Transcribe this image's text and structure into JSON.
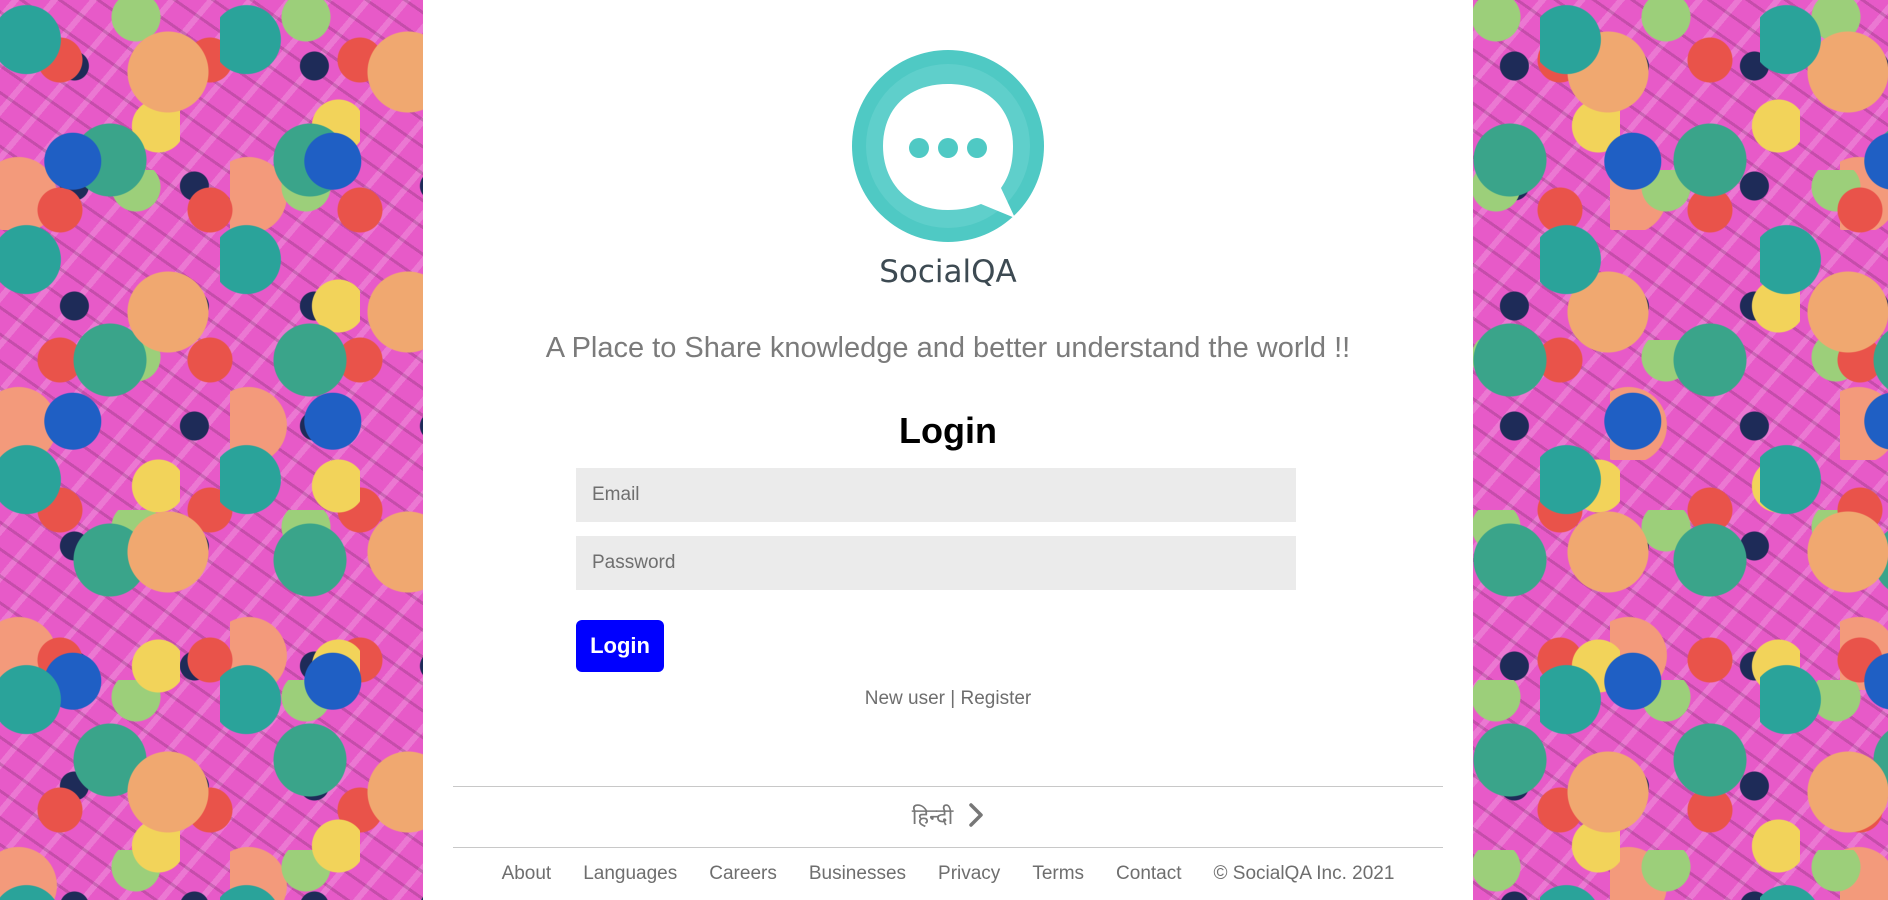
{
  "brand": {
    "name": "SocialQA",
    "logo_color": "#4fc9c4"
  },
  "tagline": "A Place to Share knowledge and better understand the world !!",
  "login": {
    "title": "Login",
    "email_placeholder": "Email",
    "password_placeholder": "Password",
    "button_label": "Login",
    "button_color": "#0000ff"
  },
  "register": {
    "prefix": "New user",
    "separator": "|",
    "link": "Register"
  },
  "language": {
    "label": "हिन्दी"
  },
  "footer": {
    "links": [
      "About",
      "Languages",
      "Careers",
      "Businesses",
      "Privacy",
      "Terms",
      "Contact"
    ],
    "copyright": "© SocialQA Inc. 2021"
  }
}
